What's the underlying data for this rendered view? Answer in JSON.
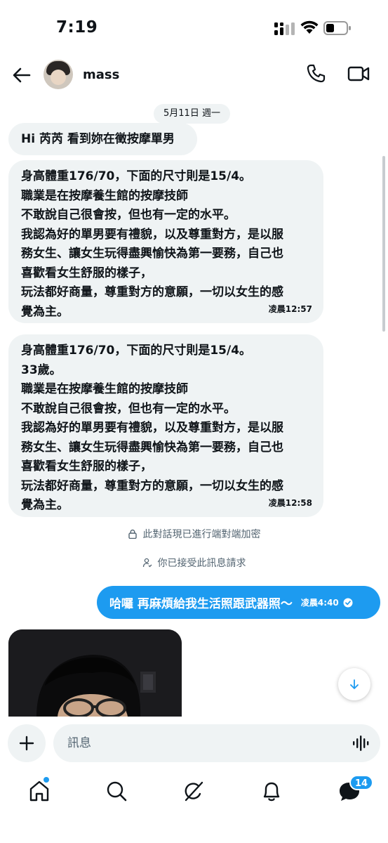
{
  "status_bar": {
    "time": "7:19"
  },
  "header": {
    "contact_name": "mass"
  },
  "conversation": {
    "date": "5月11日 週一",
    "messages": [
      {
        "lines": [
          "Hi 芮芮 看到妳在徵按摩單男"
        ],
        "time": ""
      },
      {
        "lines": [
          "身高體重176/70，下面的尺寸則是15/4。",
          "職業是在按摩養生館的按摩技師",
          "不敢說自己很會按，但也有一定的水平。",
          "我認為好的單男要有禮貌，以及尊重對方，是以服",
          "務女生、讓女生玩得盡興愉快為第一要務，自己也",
          "喜歡看女生舒服的樣子，",
          "玩法都好商量，尊重對方的意願，一切以女生的感",
          "覺為主。"
        ],
        "time": "凌晨12:57"
      },
      {
        "lines": [
          "身高體重176/70，下面的尺寸則是15/4。",
          "33歲。",
          "職業是在按摩養生館的按摩技師",
          "不敢說自己很會按，但也有一定的水平。",
          "我認為好的單男要有禮貌，以及尊重對方，是以服",
          "務女生、讓女生玩得盡興愉快為第一要務，自己也",
          "喜歡看女生舒服的樣子，",
          "玩法都好商量，尊重對方的意願，一切以女生的感",
          "覺為主。"
        ],
        "time": "凌晨12:58"
      }
    ],
    "notice_encrypted": "此對話現已進行端對端加密",
    "notice_accepted": "你已接受此訊息請求",
    "sent_message": {
      "text": "哈囉 再麻煩給我生活照跟武器照～",
      "time": "凌晨4:40"
    }
  },
  "composer": {
    "placeholder": "訊息"
  },
  "nav": {
    "messages_badge": "14"
  },
  "colors": {
    "accent": "#1d9bf0",
    "bubble_in": "#eff3f4",
    "text_secondary": "#536471"
  }
}
